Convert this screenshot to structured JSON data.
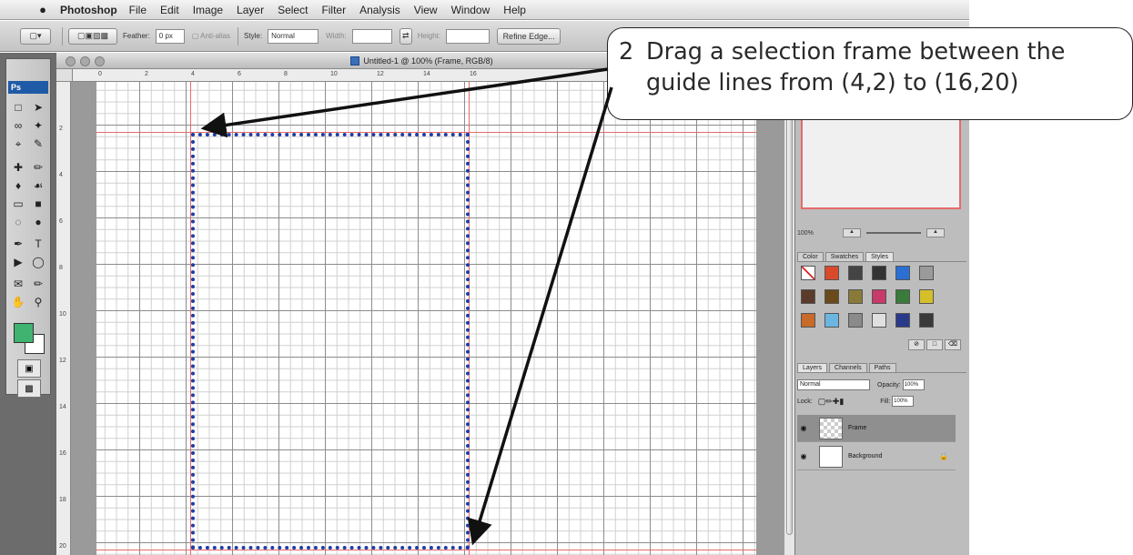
{
  "menubar": {
    "app_name": "Photoshop",
    "items": [
      "File",
      "Edit",
      "Image",
      "Layer",
      "Select",
      "Filter",
      "Analysis",
      "View",
      "Window",
      "Help"
    ]
  },
  "options_bar": {
    "feather_label": "Feather:",
    "feather_value": "0 px",
    "antialias_label": "Anti-alias",
    "style_label": "Style:",
    "style_value": "Normal",
    "width_label": "Width:",
    "height_label": "Height:",
    "refine_button": "Refine Edge..."
  },
  "tools": {
    "logo": "Ps"
  },
  "document": {
    "title": "Untitled-1 @ 100% (Frame, RGB/8)",
    "ruler_top_numbers": [
      "0",
      "2",
      "4",
      "6",
      "8",
      "10",
      "12",
      "14",
      "16"
    ],
    "ruler_left_numbers": [
      "2",
      "4",
      "6",
      "8",
      "10",
      "12",
      "14",
      "16",
      "18",
      "20"
    ]
  },
  "navigator": {
    "zoom": "100%"
  },
  "styles_panel": {
    "tabs": [
      "Color",
      "Swatches",
      "Styles"
    ]
  },
  "layers_panel": {
    "tabs": [
      "Layers",
      "Channels",
      "Paths"
    ],
    "blend_mode": "Normal",
    "opacity_label": "Opacity:",
    "opacity_value": "100%",
    "lock_label": "Lock:",
    "fill_label": "Fill:",
    "fill_value": "100%",
    "layers": [
      {
        "name": "Frame",
        "selected": true
      },
      {
        "name": "Background",
        "selected": false
      }
    ]
  },
  "callout": {
    "step_number": "2",
    "line1": "Drag a selection frame between the",
    "line2": "guide lines from (4,2) to (16,20)"
  },
  "colors": {
    "foreground": "#3fb36f",
    "background": "#ffffff",
    "guide": "#e66a6a",
    "selection": "#1f3da6"
  }
}
